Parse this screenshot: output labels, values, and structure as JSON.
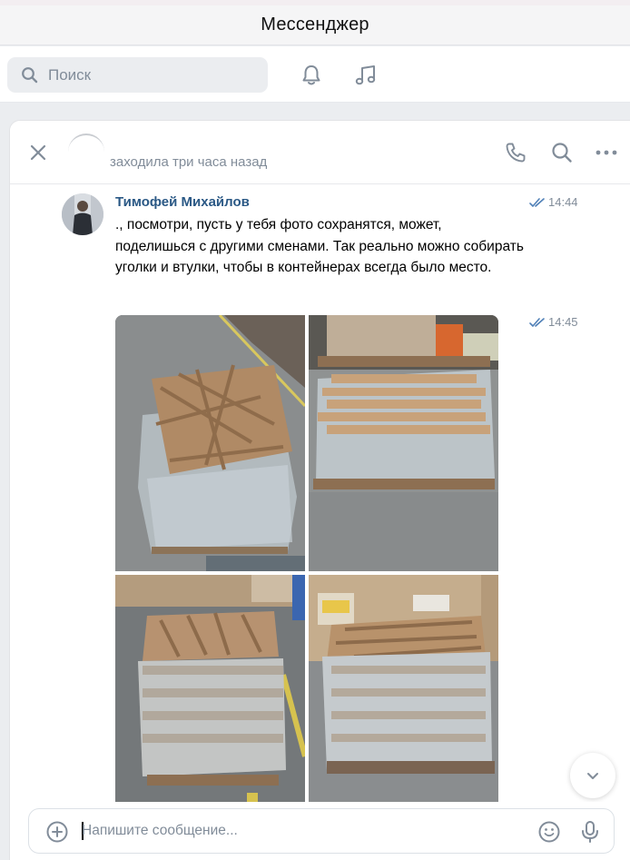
{
  "app": {
    "title": "Мессенджер"
  },
  "search": {
    "placeholder": "Поиск"
  },
  "chat": {
    "status": "заходила три часа назад",
    "messages": [
      {
        "author": "Тимофей Михайлов",
        "time": "14:44",
        "text": "., посмотри, пусть у тебя фото сохранятся, может, поделишься с другими сменами. Так реально можно собирать уголки и втулки, чтобы в контейнерах всегда было место."
      },
      {
        "time": "14:45",
        "photos": [
          "photo-pallet-corners-1",
          "photo-pallet-corners-2",
          "photo-pallet-corners-3",
          "photo-pallet-corners-4"
        ]
      }
    ]
  },
  "composer": {
    "placeholder": "Напишите сообщение..."
  },
  "colors": {
    "accent": "#2a5885",
    "icon": "#818c99",
    "read_check": "#5181b8"
  }
}
